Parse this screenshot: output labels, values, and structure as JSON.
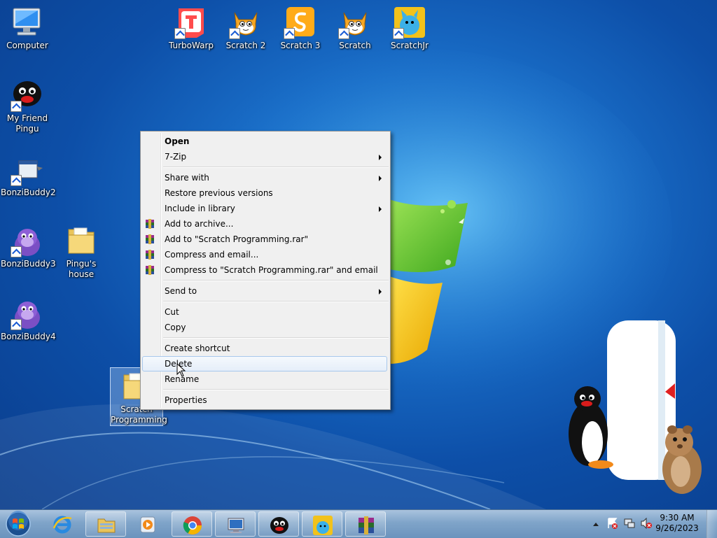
{
  "desktop": {
    "icons": [
      {
        "label": "Computer",
        "icon": "computer-icon"
      },
      {
        "label": "TurboWarp",
        "icon": "turbowarp-icon"
      },
      {
        "label": "Scratch 2",
        "icon": "scratch-cat-icon"
      },
      {
        "label": "Scratch 3",
        "icon": "scratch3-icon"
      },
      {
        "label": "Scratch",
        "icon": "scratch-cat-icon"
      },
      {
        "label": "ScratchJr",
        "icon": "scratchjr-icon"
      },
      {
        "label": "My Friend Pingu",
        "icon": "pingu-icon"
      },
      {
        "label": "BonziBuddy2",
        "icon": "bonzibuddy-icon"
      },
      {
        "label": "BonziBuddy3",
        "icon": "bonzibuddy-icon"
      },
      {
        "label": "Pingu's house",
        "icon": "folder-icon"
      },
      {
        "label": "BonziBuddy4",
        "icon": "bonzibuddy-icon"
      },
      {
        "label": "Scratch Programming",
        "icon": "folder-icon"
      }
    ]
  },
  "context_menu": {
    "items": [
      {
        "label": "Open",
        "bold": true
      },
      {
        "label": "7-Zip",
        "submenu": true
      },
      {
        "label": "Share with",
        "submenu": true
      },
      {
        "label": "Restore previous versions"
      },
      {
        "label": "Include in library",
        "submenu": true
      },
      {
        "label": "Add to archive...",
        "icon": "winrar-icon"
      },
      {
        "label": "Add to \"Scratch Programming.rar\"",
        "icon": "winrar-icon"
      },
      {
        "label": "Compress and email...",
        "icon": "winrar-icon"
      },
      {
        "label": "Compress to \"Scratch Programming.rar\" and email",
        "icon": "winrar-icon"
      },
      {
        "label": "Send to",
        "submenu": true
      },
      {
        "label": "Cut"
      },
      {
        "label": "Copy"
      },
      {
        "label": "Create shortcut"
      },
      {
        "label": "Delete",
        "highlighted": true
      },
      {
        "label": "Rename"
      },
      {
        "label": "Properties"
      }
    ]
  },
  "taskbar": {
    "start_icon": "windows-orb-icon",
    "pinned": [
      "internet-explorer-icon",
      "file-explorer-icon",
      "media-player-icon",
      "chrome-icon",
      "remote-desktop-icon",
      "pingu-icon",
      "scratchjr-icon",
      "winrar-icon"
    ],
    "tray_icons": [
      "show-hidden-icons-icon",
      "action-center-icon",
      "network-icon",
      "volume-muted-icon"
    ],
    "clock": {
      "time": "9:30 AM",
      "date": "9/26/2023"
    }
  },
  "colors": {
    "desktop_blue": "#1a6fc9",
    "menu_highlight": "#e5eef9",
    "taskbar": "#7fa4c9"
  }
}
